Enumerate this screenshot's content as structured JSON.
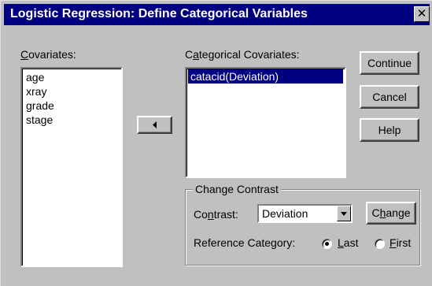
{
  "window": {
    "title": "Logistic Regression: Define Categorical Variables",
    "close_glyph": "✕"
  },
  "covariates": {
    "label_key": "C",
    "label_rest": "ovariates:",
    "items": [
      "age",
      "xray",
      "grade",
      "stage"
    ]
  },
  "move_button": {
    "direction": "left",
    "icon": "triangle-left-icon"
  },
  "categorical": {
    "label_pre": "C",
    "label_key": "a",
    "label_rest": "tegorical Covariates:",
    "items": [
      "catacid(Deviation)"
    ],
    "selected_index": 0
  },
  "buttons": {
    "continue": "Continue",
    "cancel": "Cancel",
    "help": "Help"
  },
  "change_contrast": {
    "legend": "Change Contrast",
    "contrast_label_pre": "Co",
    "contrast_label_key": "n",
    "contrast_label_rest": "trast:",
    "contrast_value": "Deviation",
    "change_pre": "C",
    "change_key": "h",
    "change_rest": "ange",
    "reference_label": "Reference Category:",
    "last_key": "L",
    "last_rest": "ast",
    "first_key": "F",
    "first_rest": "irst",
    "reference_selected": "last"
  },
  "colors": {
    "titlebar": "#000080",
    "face": "#c0c0c0",
    "selection": "#000080"
  }
}
